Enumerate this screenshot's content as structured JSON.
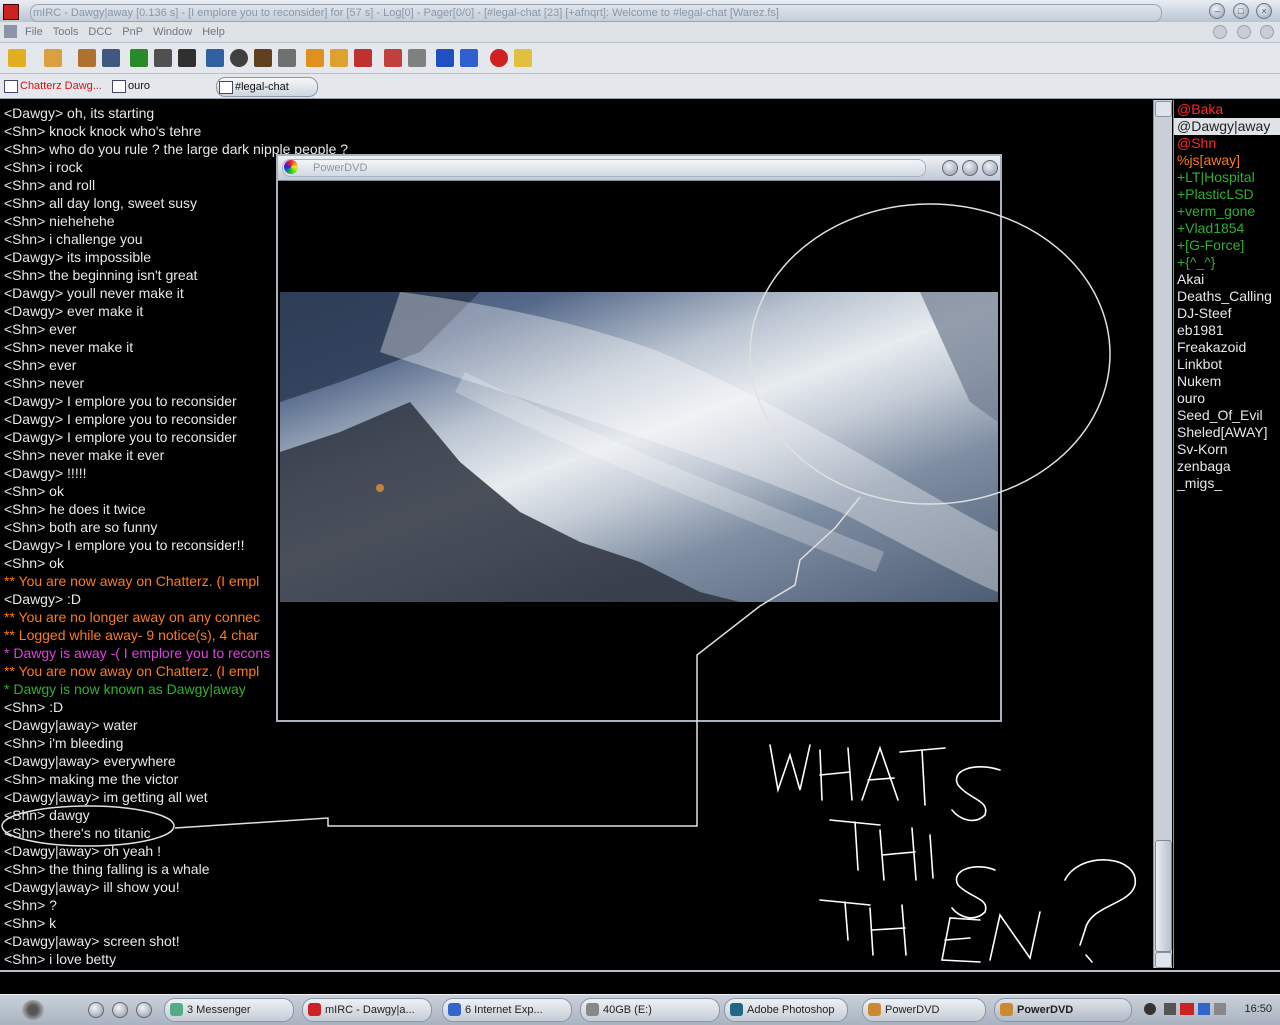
{
  "window": {
    "title": "mIRC - Dawgy|away [0.136 s] - [I emplore you to reconsider] for [57 s] - Log[0] - Pager[0/0] - [#legal-chat [23] [+afnqrt]: Welcome to #legal-chat [Warez.fs]"
  },
  "menu": [
    "File",
    "Tools",
    "DCC",
    "PnP",
    "Window",
    "Help"
  ],
  "switchbar": {
    "tabs": [
      {
        "label": "Chatterz Dawg...",
        "color": "#d11"
      },
      {
        "label": "ouro",
        "color": "#111"
      },
      {
        "label": "#legal-chat",
        "color": "#111"
      }
    ]
  },
  "chat": {
    "lines": [
      {
        "text": "<Dawgy> oh, its starting",
        "color": "#e8e8e8"
      },
      {
        "text": "<Shn> knock knock who's tehre",
        "color": "#e8e8e8"
      },
      {
        "text": "<Shn> who do you rule ? the large dark nipple people ?",
        "color": "#e8e8e8"
      },
      {
        "text": "<Shn> i rock",
        "color": "#e8e8e8"
      },
      {
        "text": "<Shn> and roll",
        "color": "#e8e8e8"
      },
      {
        "text": "<Shn> all day long, sweet susy",
        "color": "#e8e8e8"
      },
      {
        "text": "<Shn> niehehehe",
        "color": "#e8e8e8"
      },
      {
        "text": "<Shn> i challenge you",
        "color": "#e8e8e8"
      },
      {
        "text": "<Dawgy> its impossible",
        "color": "#e8e8e8"
      },
      {
        "text": "<Shn> the beginning isn't great",
        "color": "#e8e8e8"
      },
      {
        "text": "<Dawgy> youll never make it",
        "color": "#e8e8e8"
      },
      {
        "text": "<Dawgy> ever make it",
        "color": "#e8e8e8"
      },
      {
        "text": "<Shn> ever",
        "color": "#e8e8e8"
      },
      {
        "text": "<Shn> never make it",
        "color": "#e8e8e8"
      },
      {
        "text": "<Shn> ever",
        "color": "#e8e8e8"
      },
      {
        "text": "<Shn> never",
        "color": "#e8e8e8"
      },
      {
        "text": "<Dawgy> I emplore you to reconsider",
        "color": "#e8e8e8"
      },
      {
        "text": "<Dawgy> I emplore you to reconsider",
        "color": "#e8e8e8"
      },
      {
        "text": "<Dawgy> I emplore you to reconsider",
        "color": "#e8e8e8"
      },
      {
        "text": "<Shn> never make it ever",
        "color": "#e8e8e8"
      },
      {
        "text": "<Dawgy> !!!!!",
        "color": "#e8e8e8"
      },
      {
        "text": "<Shn> ok",
        "color": "#e8e8e8"
      },
      {
        "text": "<Shn> he does it twice",
        "color": "#e8e8e8"
      },
      {
        "text": "<Shn> both are so funny",
        "color": "#e8e8e8"
      },
      {
        "text": "<Dawgy> I emplore you to reconsider!!",
        "color": "#e8e8e8"
      },
      {
        "text": "<Shn> ok",
        "color": "#e8e8e8"
      },
      {
        "text": " ** You are now away on Chatterz. (I empl",
        "color": "#ff7a1a"
      },
      {
        "text": "<Dawgy> :D",
        "color": "#e8e8e8"
      },
      {
        "text": " ** You are no longer away on any connec",
        "color": "#ff7a1a"
      },
      {
        "text": " ** Logged while away- 9 notice(s), 4 char",
        "color": "#ff7a1a"
      },
      {
        "text": "* Dawgy is away -( I emplore you to recons",
        "color": "#e040e0"
      },
      {
        "text": " ** You are now away on Chatterz. (I empl",
        "color": "#ff7a1a"
      },
      {
        "text": "* Dawgy is now known as Dawgy|away",
        "color": "#2fb02f"
      },
      {
        "text": "<Shn> :D",
        "color": "#e8e8e8"
      },
      {
        "text": "<Dawgy|away> water",
        "color": "#e8e8e8"
      },
      {
        "text": "<Shn> i'm bleeding",
        "color": "#e8e8e8"
      },
      {
        "text": "<Dawgy|away> everywhere",
        "color": "#e8e8e8"
      },
      {
        "text": "<Shn> making me the victor",
        "color": "#e8e8e8"
      },
      {
        "text": "<Dawgy|away> im getting all wet",
        "color": "#e8e8e8"
      },
      {
        "text": "<Shn> dawgy",
        "color": "#e8e8e8"
      },
      {
        "text": "<Shn> there's no titanic",
        "color": "#e8e8e8"
      },
      {
        "text": "<Dawgy|away> oh yeah !",
        "color": "#e8e8e8"
      },
      {
        "text": "<Shn> the thing falling is a whale",
        "color": "#e8e8e8"
      },
      {
        "text": "<Dawgy|away> ill show you!",
        "color": "#e8e8e8"
      },
      {
        "text": "<Shn> ?",
        "color": "#e8e8e8"
      },
      {
        "text": "<Shn> k",
        "color": "#e8e8e8"
      },
      {
        "text": "<Dawgy|away> screen shot!",
        "color": "#e8e8e8"
      },
      {
        "text": "<Shn> i love betty",
        "color": "#e8e8e8"
      }
    ]
  },
  "nicklist": [
    {
      "nick": "@Baka",
      "color": "#ff2b2b"
    },
    {
      "nick": "@Dawgy|away",
      "color": "#222",
      "selected": true
    },
    {
      "nick": "@Shn",
      "color": "#ff2b2b"
    },
    {
      "nick": "%js[away]",
      "color": "#ff7a1a"
    },
    {
      "nick": "+LT|Hospital",
      "color": "#2fb02f"
    },
    {
      "nick": "+PlasticLSD",
      "color": "#2fb02f"
    },
    {
      "nick": "+verm_gone",
      "color": "#2fb02f"
    },
    {
      "nick": "+Vlad1854",
      "color": "#2fb02f"
    },
    {
      "nick": "+[G-Force]",
      "color": "#2fb02f"
    },
    {
      "nick": "+{^_^}",
      "color": "#2fb02f"
    },
    {
      "nick": "Akai",
      "color": "#e8e8e8"
    },
    {
      "nick": "Deaths_Calling",
      "color": "#e8e8e8"
    },
    {
      "nick": "DJ-Steef",
      "color": "#e8e8e8"
    },
    {
      "nick": "eb1981",
      "color": "#e8e8e8"
    },
    {
      "nick": "Freakazoid",
      "color": "#e8e8e8"
    },
    {
      "nick": "Linkbot",
      "color": "#e8e8e8"
    },
    {
      "nick": "Nukem",
      "color": "#e8e8e8"
    },
    {
      "nick": "ouro",
      "color": "#e8e8e8"
    },
    {
      "nick": "Seed_Of_Evil",
      "color": "#e8e8e8"
    },
    {
      "nick": "Sheled[AWAY]",
      "color": "#e8e8e8"
    },
    {
      "nick": "Sv-Korn",
      "color": "#e8e8e8"
    },
    {
      "nick": "zenbaga",
      "color": "#e8e8e8"
    },
    {
      "nick": "_migs_",
      "color": "#e8e8e8"
    }
  ],
  "input": {
    "value": ""
  },
  "powerdvd": {
    "title": "PowerDVD"
  },
  "annotation": {
    "text": "WHATS THIS THEN?"
  },
  "taskbar": {
    "items": [
      {
        "label": "3 Messenger",
        "icon": "#5a8"
      },
      {
        "label": "mIRC - Dawgy|a...",
        "icon": "#c22"
      },
      {
        "label": "6 Internet Exp...",
        "icon": "#36c"
      },
      {
        "label": "40GB (E:)",
        "icon": "#888"
      },
      {
        "label": "Adobe Photoshop",
        "icon": "#268"
      },
      {
        "label": "PowerDVD",
        "icon": "#c83"
      },
      {
        "label": "PowerDVD",
        "icon": "#c83",
        "active": true
      }
    ],
    "clock": "16:50"
  },
  "colors": {
    "accent": "#8894a3",
    "chat_bg": "#000000"
  }
}
